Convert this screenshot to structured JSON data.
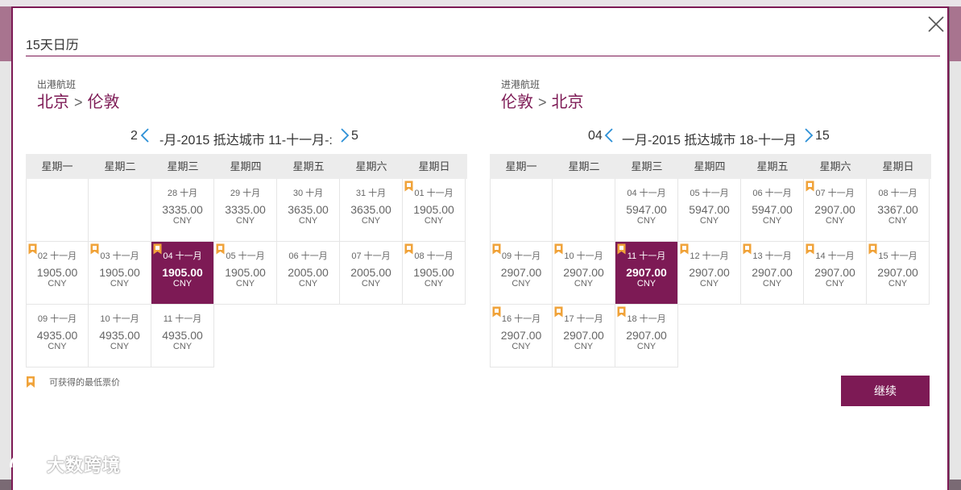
{
  "modal": {
    "title": "15天日历",
    "continue_label": "继续"
  },
  "outbound": {
    "label": "出港航班",
    "from": "北京",
    "to": "伦敦",
    "nav_prefix": "2",
    "nav_middle": "-月-2015 抵达城市 11-十一月-:",
    "nav_suffix": "5",
    "weekdays": [
      "星期一",
      "星期二",
      "星期三",
      "星期四",
      "星期五",
      "星期六",
      "星期日"
    ],
    "cells": [
      {
        "row": 0,
        "col": 0,
        "blank": true
      },
      {
        "row": 0,
        "col": 1,
        "blank": true
      },
      {
        "row": 0,
        "col": 2,
        "date": "28 十月",
        "price": "3335.00",
        "currency": "CNY"
      },
      {
        "row": 0,
        "col": 3,
        "date": "29 十月",
        "price": "3335.00",
        "currency": "CNY"
      },
      {
        "row": 0,
        "col": 4,
        "date": "30 十月",
        "price": "3635.00",
        "currency": "CNY"
      },
      {
        "row": 0,
        "col": 5,
        "date": "31 十月",
        "price": "3635.00",
        "currency": "CNY"
      },
      {
        "row": 0,
        "col": 6,
        "date": "01 十一月",
        "price": "1905.00",
        "currency": "CNY",
        "lowest": true
      },
      {
        "row": 1,
        "col": 0,
        "date": "02 十一月",
        "price": "1905.00",
        "currency": "CNY",
        "lowest": true
      },
      {
        "row": 1,
        "col": 1,
        "date": "03 十一月",
        "price": "1905.00",
        "currency": "CNY",
        "lowest": true
      },
      {
        "row": 1,
        "col": 2,
        "date": "04 十一月",
        "price": "1905.00",
        "currency": "CNY",
        "lowest": true,
        "selected": true
      },
      {
        "row": 1,
        "col": 3,
        "date": "05 十一月",
        "price": "1905.00",
        "currency": "CNY",
        "lowest": true
      },
      {
        "row": 1,
        "col": 4,
        "date": "06 十一月",
        "price": "2005.00",
        "currency": "CNY"
      },
      {
        "row": 1,
        "col": 5,
        "date": "07 十一月",
        "price": "2005.00",
        "currency": "CNY"
      },
      {
        "row": 1,
        "col": 6,
        "date": "08 十一月",
        "price": "1905.00",
        "currency": "CNY",
        "lowest": true
      },
      {
        "row": 2,
        "col": 0,
        "date": "09 十一月",
        "price": "4935.00",
        "currency": "CNY"
      },
      {
        "row": 2,
        "col": 1,
        "date": "10 十一月",
        "price": "4935.00",
        "currency": "CNY"
      },
      {
        "row": 2,
        "col": 2,
        "date": "11 十一月",
        "price": "4935.00",
        "currency": "CNY"
      }
    ]
  },
  "inbound": {
    "label": "进港航班",
    "from": "伦敦",
    "to": "北京",
    "nav_prefix": "04",
    "nav_middle": "一月-2015 抵达城市 18-十一月",
    "nav_suffix": "15",
    "weekdays": [
      "星期一",
      "星期二",
      "星期三",
      "星期四",
      "星期五",
      "星期六",
      "星期日"
    ],
    "cells": [
      {
        "row": 0,
        "col": 0,
        "blank": true
      },
      {
        "row": 0,
        "col": 1,
        "blank": true
      },
      {
        "row": 0,
        "col": 2,
        "date": "04 十一月",
        "price": "5947.00",
        "currency": "CNY"
      },
      {
        "row": 0,
        "col": 3,
        "date": "05 十一月",
        "price": "5947.00",
        "currency": "CNY"
      },
      {
        "row": 0,
        "col": 4,
        "date": "06 十一月",
        "price": "5947.00",
        "currency": "CNY"
      },
      {
        "row": 0,
        "col": 5,
        "date": "07 十一月",
        "price": "2907.00",
        "currency": "CNY",
        "lowest": true
      },
      {
        "row": 0,
        "col": 6,
        "date": "08 十一月",
        "price": "3367.00",
        "currency": "CNY"
      },
      {
        "row": 1,
        "col": 0,
        "date": "09 十一月",
        "price": "2907.00",
        "currency": "CNY",
        "lowest": true
      },
      {
        "row": 1,
        "col": 1,
        "date": "10 十一月",
        "price": "2907.00",
        "currency": "CNY",
        "lowest": true
      },
      {
        "row": 1,
        "col": 2,
        "date": "11 十一月",
        "price": "2907.00",
        "currency": "CNY",
        "lowest": true,
        "selected": true
      },
      {
        "row": 1,
        "col": 3,
        "date": "12 十一月",
        "price": "2907.00",
        "currency": "CNY",
        "lowest": true
      },
      {
        "row": 1,
        "col": 4,
        "date": "13 十一月",
        "price": "2907.00",
        "currency": "CNY",
        "lowest": true
      },
      {
        "row": 1,
        "col": 5,
        "date": "14 十一月",
        "price": "2907.00",
        "currency": "CNY",
        "lowest": true
      },
      {
        "row": 1,
        "col": 6,
        "date": "15 十一月",
        "price": "2907.00",
        "currency": "CNY",
        "lowest": true
      },
      {
        "row": 2,
        "col": 0,
        "date": "16 十一月",
        "price": "2907.00",
        "currency": "CNY",
        "lowest": true
      },
      {
        "row": 2,
        "col": 1,
        "date": "17 十一月",
        "price": "2907.00",
        "currency": "CNY",
        "lowest": true
      },
      {
        "row": 2,
        "col": 2,
        "date": "18 十一月",
        "price": "2907.00",
        "currency": "CNY",
        "lowest": true
      }
    ]
  },
  "legend": {
    "text": "可获得的最低票价",
    "icon": "ribbon-icon"
  },
  "watermark": {
    "text": "大数跨境",
    "icon": "logo-icon"
  },
  "colors": {
    "accent": "#7d1a55",
    "ribbon": "#f0a33a",
    "nav_arrow": "#2b8fd6"
  }
}
